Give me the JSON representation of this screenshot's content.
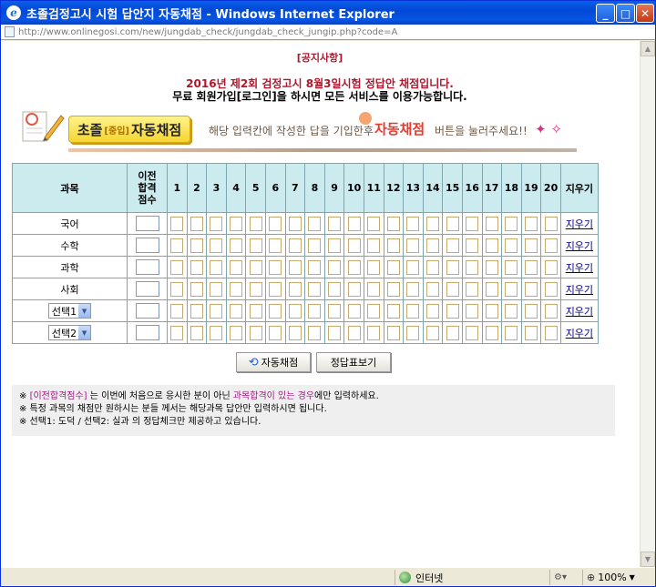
{
  "window": {
    "title": "초졸검정고시 시험 답안지 자동채점 - Windows Internet Explorer",
    "url": "http://www.onlinegosi.com/new/jungdab_check/jungdab_check_jungip.php?code=A"
  },
  "page": {
    "notice": "[공지사항]",
    "line1": "2016년 제2회 검정고시 8월3일시험 정답안 채점입니다.",
    "line2": "무료 회원가입[로그인]을 하시면 모든 서비스를 이용가능합니다."
  },
  "banner": {
    "button_prefix": "초졸",
    "button_tag": "[중입]",
    "button_main": "자동채점",
    "instruction": "해당 입력칸에 작성한 답을 기입한후",
    "autograde": "자동채점",
    "press": "버튼을 눌러주세요!!",
    "stars": "✦ ✧"
  },
  "table": {
    "header_subject": "과목",
    "header_prev": "이전 합격 점수",
    "questions": [
      "1",
      "2",
      "3",
      "4",
      "5",
      "6",
      "7",
      "8",
      "9",
      "10",
      "11",
      "12",
      "13",
      "14",
      "15",
      "16",
      "17",
      "18",
      "19",
      "20"
    ],
    "header_clear": "지우기",
    "rows": [
      {
        "subject": "국어",
        "clear": "지우기"
      },
      {
        "subject": "수학",
        "clear": "지우기"
      },
      {
        "subject": "과학",
        "clear": "지우기"
      },
      {
        "subject": "사회",
        "clear": "지우기"
      },
      {
        "subject": "선택1",
        "clear": "지우기"
      },
      {
        "subject": "선택2",
        "clear": "지우기"
      }
    ]
  },
  "buttons": {
    "autograde": "자동채점",
    "answer_key": "정답표보기"
  },
  "notes": {
    "n1_mark": "※ ",
    "n1_a": "[이전합격점수]",
    "n1_b": " 는 이번에 처음으로 응시한 분이 아닌 ",
    "n1_c": "과목합격이 있는 경우",
    "n1_d": "에만 입력하세요.",
    "n2": "※ 특정 과목의 채점만 원하시는 분들 께서는 해당과목 답안만 입력하시면 됩니다.",
    "n3": "※ 선택1: 도덕 / 선택2: 실과 의 정답체크만 제공하고 있습니다."
  },
  "statusbar": {
    "zone": "인터넷",
    "zoom": "100%"
  }
}
